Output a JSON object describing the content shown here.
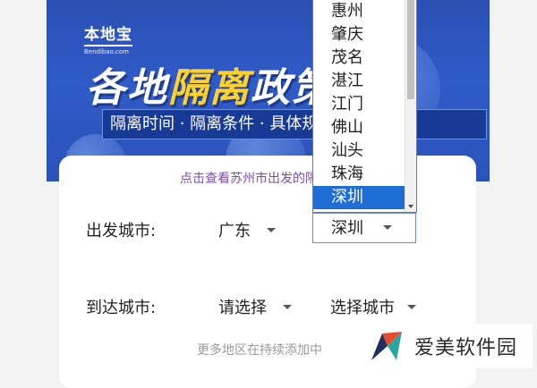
{
  "banner": {
    "logo_main": "本地宝",
    "logo_sub": "Bendibao.com",
    "title_part1": "各地",
    "title_highlight": "隔离",
    "title_part2": "政策",
    "tagline": "隔离时间 · 隔离条件 · 具体规定"
  },
  "card": {
    "link_text": "点击查看苏州市出发的隔离政策",
    "departure": {
      "label": "出发城市:",
      "province": "广东",
      "city": "深圳"
    },
    "arrival": {
      "label": "到达城市:",
      "province": "请选择",
      "city": "选择城市"
    },
    "footer_note": "更多地区在持续添加中"
  },
  "dropdown": {
    "options": [
      "惠州",
      "肇庆",
      "茂名",
      "湛江",
      "江门",
      "佛山",
      "汕头",
      "珠海",
      "深圳"
    ],
    "selected_index": 8,
    "scroll_fraction": 0.5
  },
  "watermark": {
    "text": "爱美软件园"
  },
  "colors": {
    "banner_blue": "#2f5bc7",
    "highlight_yellow": "#ffd12a",
    "link_purple": "#7b4fa8",
    "selected_blue": "#1e6ed6"
  }
}
